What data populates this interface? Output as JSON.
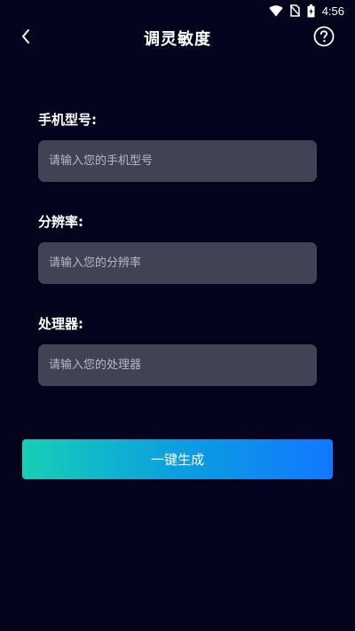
{
  "status_bar": {
    "time": "4:56",
    "icons": [
      "wifi-icon",
      "no-sim-icon",
      "battery-charging-icon"
    ]
  },
  "header": {
    "title": "调灵敏度",
    "back_icon": "chevron-left-icon",
    "help_icon": "question-circle-icon"
  },
  "form": {
    "fields": [
      {
        "label": "手机型号:",
        "value": "",
        "placeholder": "请输入您的手机型号"
      },
      {
        "label": "分辨率:",
        "value": "",
        "placeholder": "请输入您的分辨率"
      },
      {
        "label": "处理器:",
        "value": "",
        "placeholder": "请输入您的处理器"
      }
    ]
  },
  "actions": {
    "generate_label": "一键生成"
  },
  "colors": {
    "background": "#03031c",
    "input_background": "#404353",
    "button_gradient_start": "#17cfb6",
    "button_gradient_end": "#1178ff"
  }
}
